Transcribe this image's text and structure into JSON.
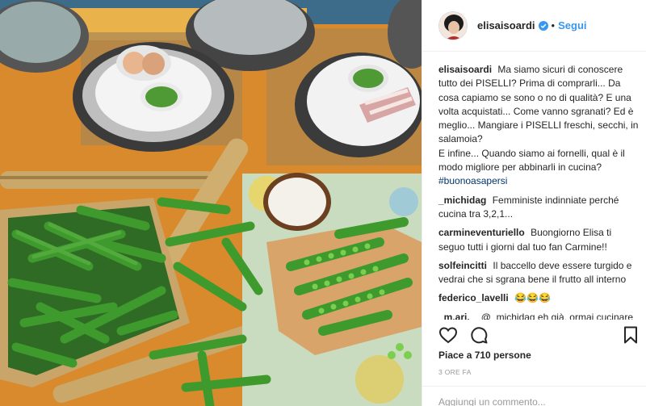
{
  "photo": {
    "alt_icon": "food-photo",
    "colors": {
      "tablecloth": "#d98a2c",
      "pea": "#3a8a2a",
      "plate": "#f3f3f3",
      "bamboo": "#c9a86a"
    }
  },
  "post": {
    "username": "elisaisoardi",
    "verified_icon": "verified-badge-icon",
    "separator": "•",
    "follow_label": "Segui"
  },
  "caption": {
    "user": "elisaisoardi",
    "text": "Ma siamo sicuri di conoscere tutto dei PISELLI? Prima di comprarli... Da cosa capiamo se sono o no di qualità? E una volta acquistati... Come vanno sgranati? Ed è meglio... Mangiare i PISELLI freschi, secchi, in salamoia?\nE infine... Quando siamo ai fornelli, qual è il modo migliore per abbinarli in cucina?",
    "hashtag": "#buonoasapersi"
  },
  "comments": [
    {
      "user": "_michidag",
      "text": "Femministe indinniate perché cucina tra 3,2,1..."
    },
    {
      "user": "carmineventuriello",
      "text": "Buongiorno Elisa ti seguo tutti i giorni dal tuo fan Carmine!!"
    },
    {
      "user": "solfeincitti",
      "text": "Il baccello deve essere turgido e vedrai che si sgrana bene il frutto all interno"
    },
    {
      "user": "federico_lavelli",
      "text": "😂😂😂"
    },
    {
      "user": "_m.ari._",
      "text": "@_michidag eh già, ormai cucinare è roba da donne sottomesse al"
    }
  ],
  "actions": {
    "like_icon": "heart-icon",
    "comment_icon": "comment-icon",
    "save_icon": "bookmark-icon"
  },
  "likes_text": "Piace a 710 persone",
  "time_text": "3 ORE FA",
  "add_comment": {
    "placeholder": "Aggiungi un commento..."
  },
  "colors": {
    "link": "#3897f0",
    "hashtag": "#003569",
    "muted": "#999999",
    "text": "#262626",
    "border": "#efefef"
  }
}
